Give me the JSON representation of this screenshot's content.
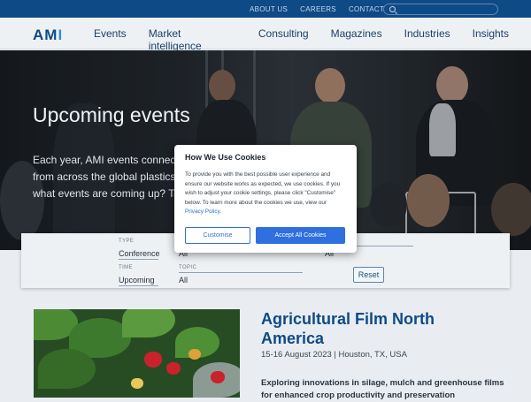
{
  "topbar": {
    "links": [
      "ABOUT US",
      "CAREERS",
      "CONTACT US"
    ],
    "search_placeholder": ""
  },
  "nav": {
    "logo_a": "AM",
    "logo_b": "I",
    "items": [
      "Events",
      "Market intelligence",
      "Consulting",
      "Magazines",
      "Industries",
      "Insights"
    ],
    "active": "Events"
  },
  "hero": {
    "title": "Upcoming events",
    "text_line1": "Each year, AMI events connect",
    "text_line2": "from across the global plastics",
    "text_line3": "what events are coming up? Ta"
  },
  "filters": {
    "type_label": "TYPE",
    "type_value": "Conference",
    "col2_value": "All",
    "col4_value": "All",
    "time_label": "TIME",
    "time_value": "Upcoming",
    "topic_label": "TOPIC",
    "topic_value": "All",
    "reset_label": "Reset"
  },
  "cookie": {
    "title": "How We Use Cookies",
    "text": "To provide you with the best possible user experience and ensure our website works as expected, we use cookies. If you wish to adjust your cookie settings, please click \"Customise\" below. To learn more about the cookies we use, view our",
    "link": "Privacy Policy",
    "after_link": ".",
    "customise_label": "Customise",
    "accept_label": "Accept All Cookies"
  },
  "event": {
    "title": "Agricultural Film North America",
    "date": "15-16 August 2023 | Houston, TX, USA",
    "desc": "Exploring innovations in silage, mulch and greenhouse films for enhanced crop productivity and preservation"
  },
  "colors": {
    "brand": "#0e4a86",
    "accent": "#2f8ee0",
    "button": "#2f6fe0"
  }
}
